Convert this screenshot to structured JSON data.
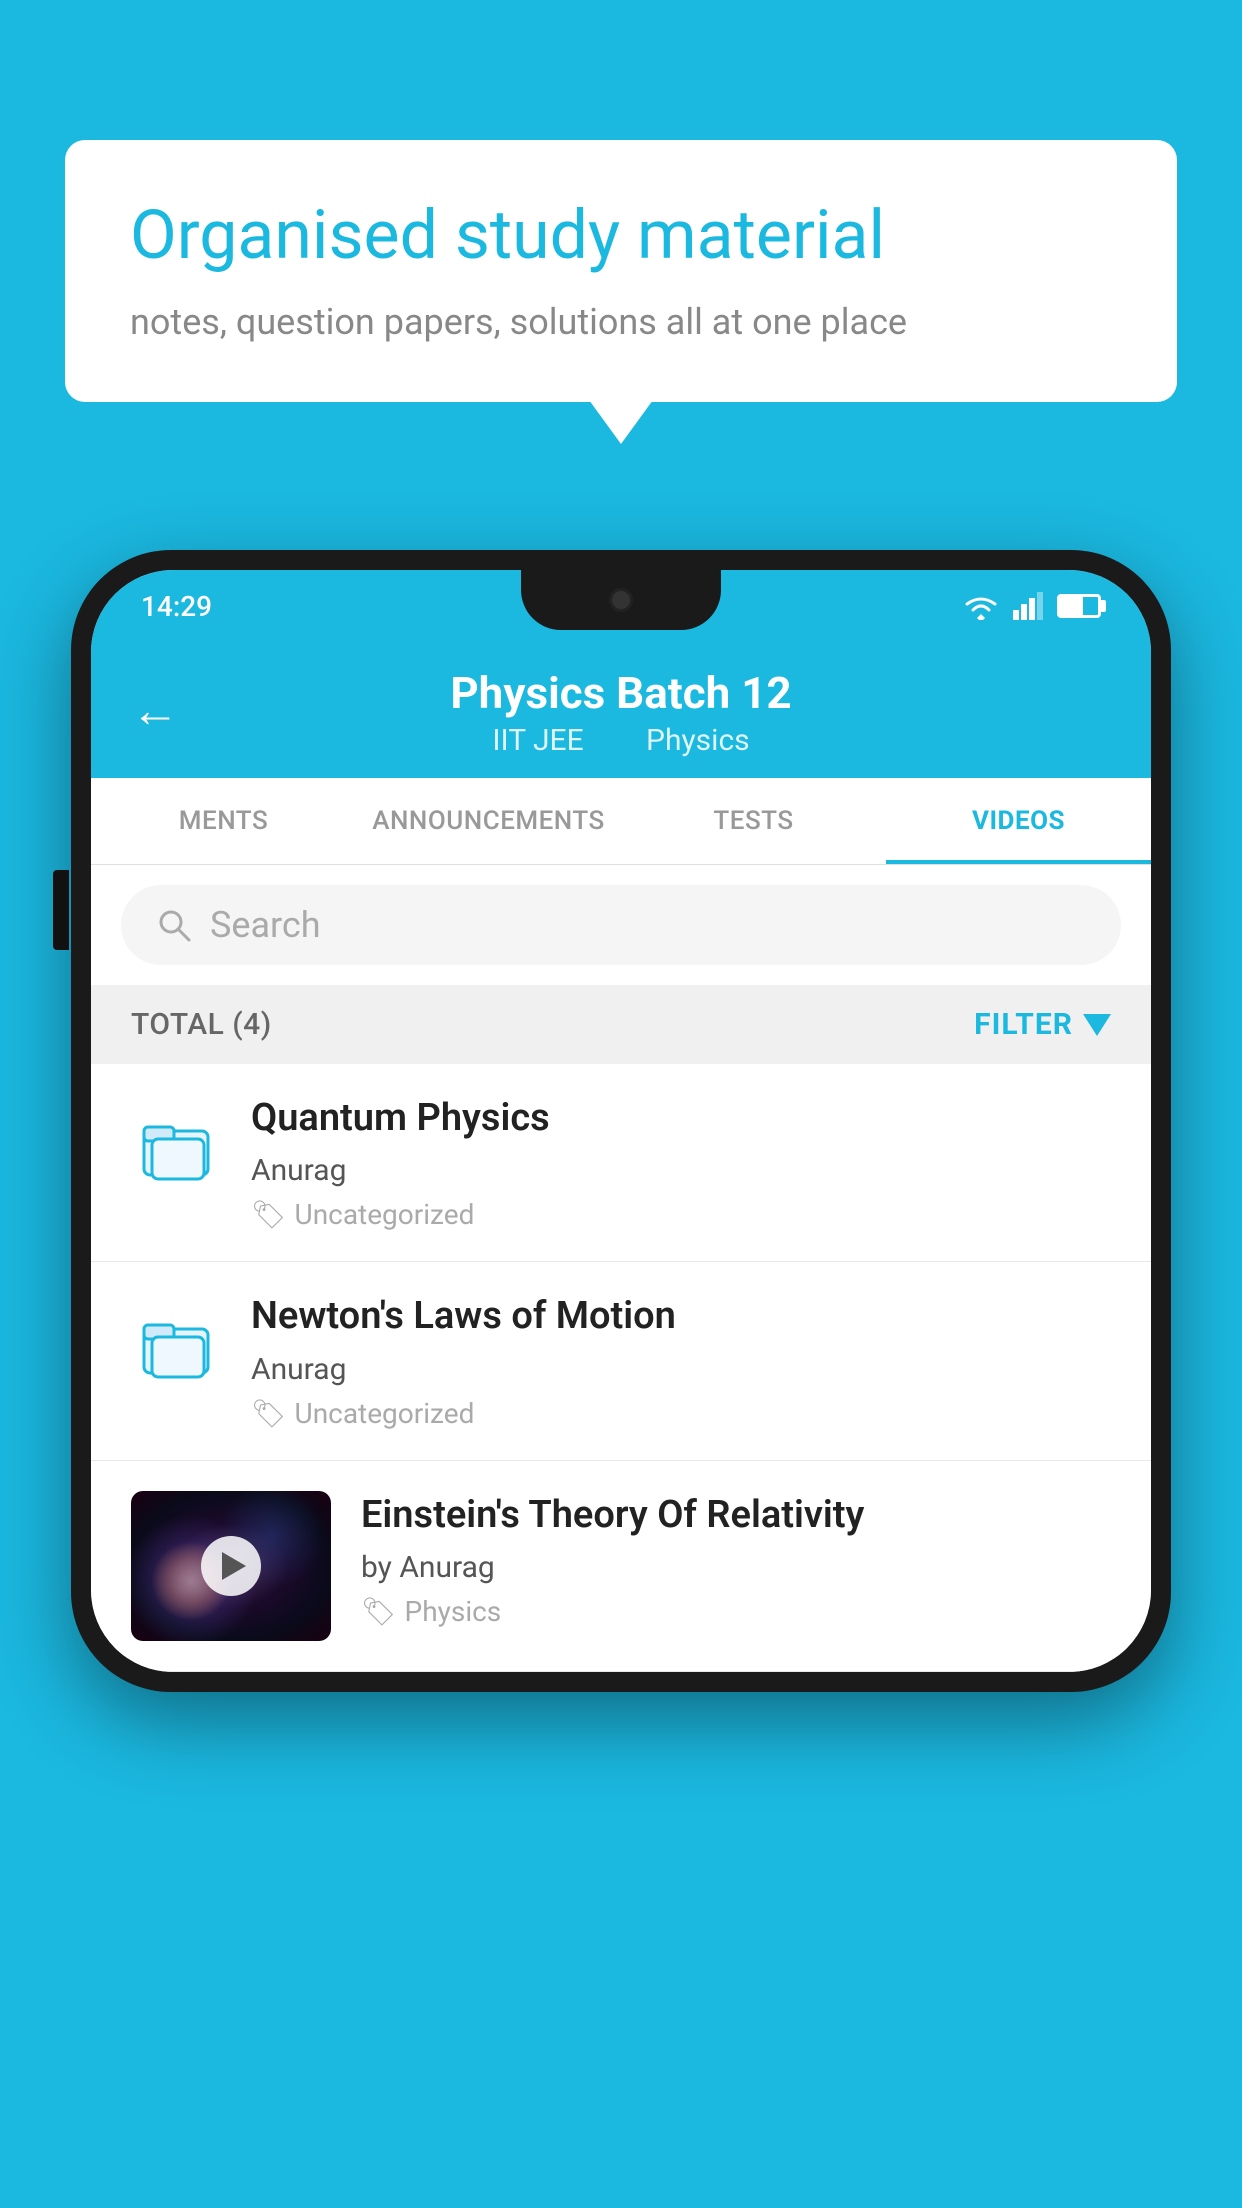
{
  "background": {
    "color": "#1BB8E0"
  },
  "speech_bubble": {
    "title": "Organised study material",
    "subtitle": "notes, question papers, solutions all at one place"
  },
  "phone": {
    "status_bar": {
      "time": "14:29"
    },
    "header": {
      "title": "Physics Batch 12",
      "subtitle_part1": "IIT JEE",
      "subtitle_part2": "Physics",
      "back_label": "←"
    },
    "tabs": [
      {
        "label": "MENTS",
        "active": false
      },
      {
        "label": "ANNOUNCEMENTS",
        "active": false
      },
      {
        "label": "TESTS",
        "active": false
      },
      {
        "label": "VIDEOS",
        "active": true
      }
    ],
    "search": {
      "placeholder": "Search"
    },
    "filter_bar": {
      "total_label": "TOTAL (4)",
      "filter_label": "FILTER"
    },
    "videos": [
      {
        "title": "Quantum Physics",
        "author": "Anurag",
        "tag": "Uncategorized",
        "has_thumbnail": false
      },
      {
        "title": "Newton's Laws of Motion",
        "author": "Anurag",
        "tag": "Uncategorized",
        "has_thumbnail": false
      },
      {
        "title": "Einstein's Theory Of Relativity",
        "author": "by Anurag",
        "tag": "Physics",
        "has_thumbnail": true
      }
    ]
  }
}
